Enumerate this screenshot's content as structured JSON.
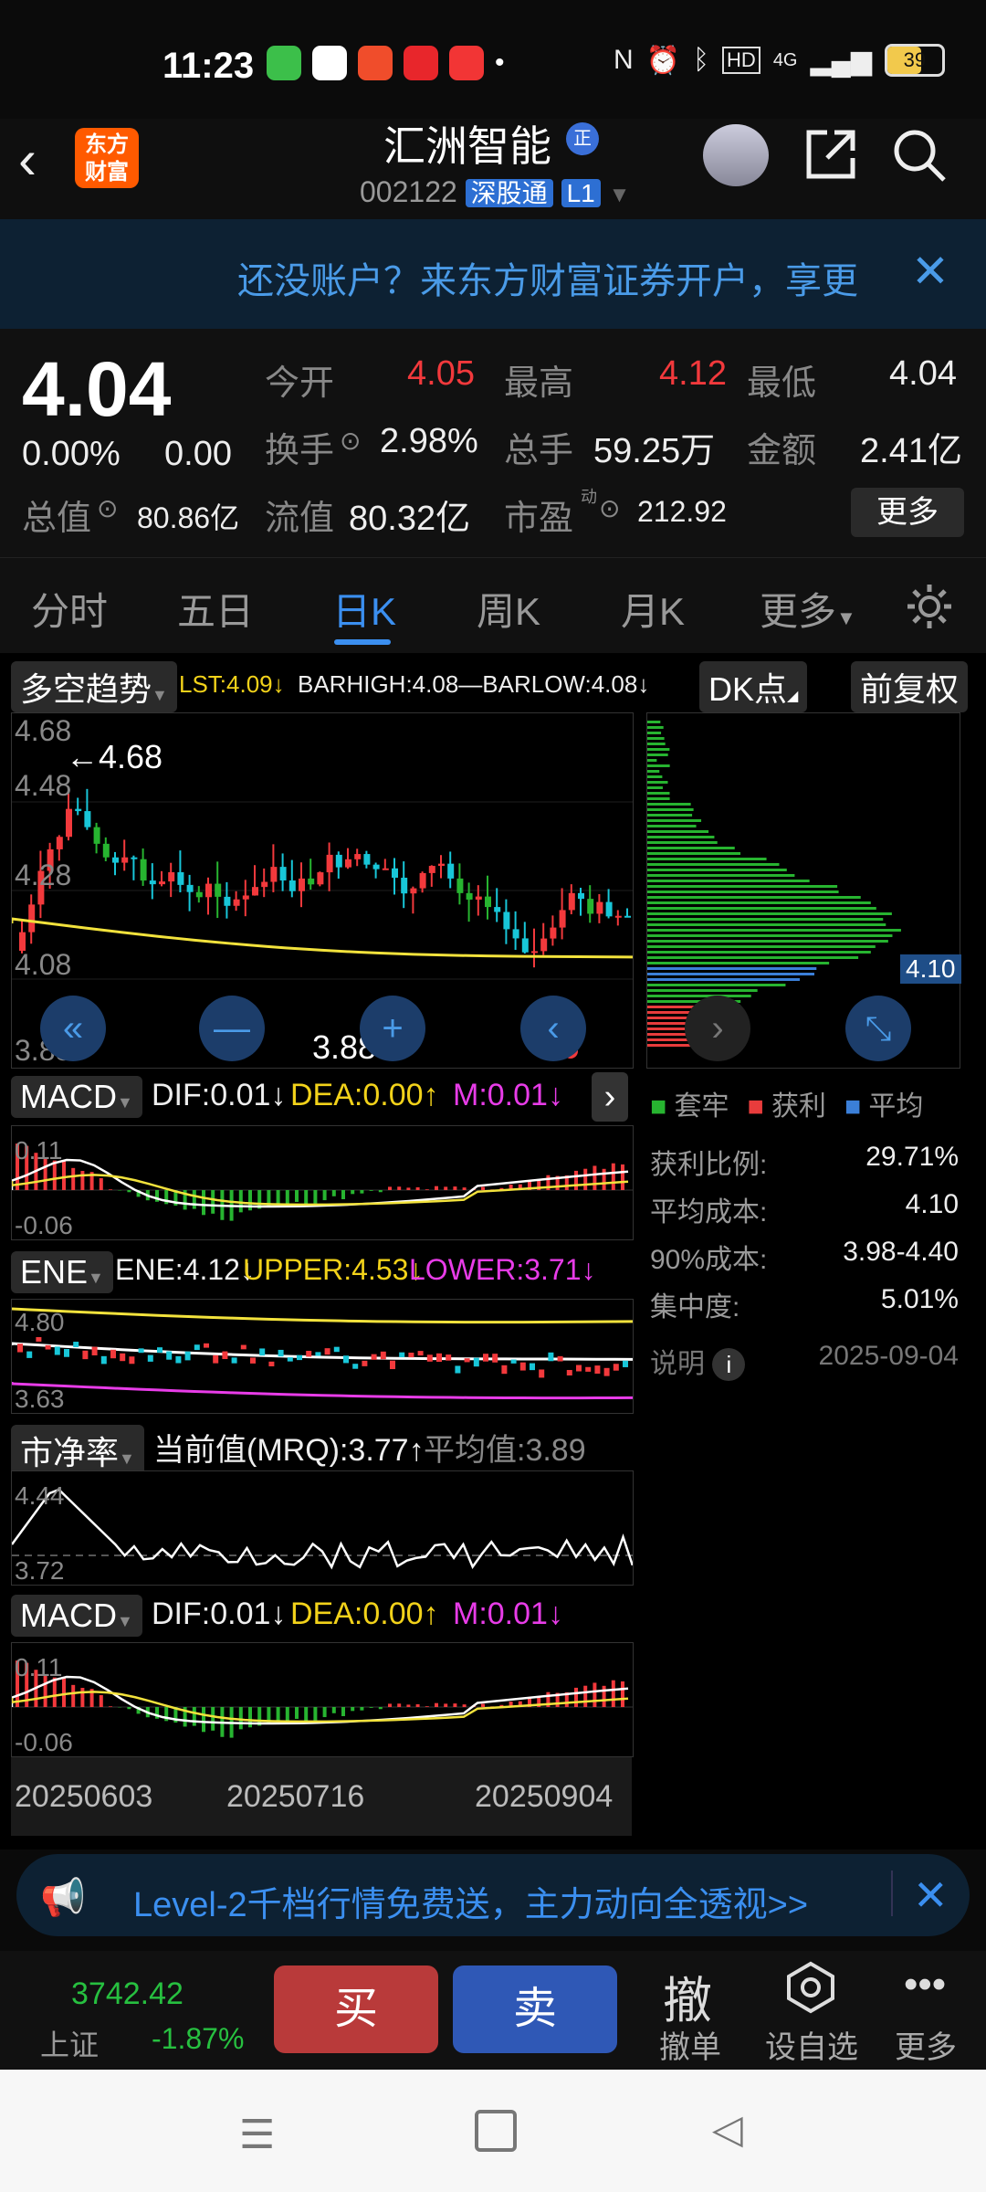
{
  "status": {
    "time": "11:23",
    "battery": "39",
    "network": "4G"
  },
  "header": {
    "logo_line1": "东方",
    "logo_line2": "财富",
    "name": "汇洲智能",
    "badge": "正",
    "code": "002122",
    "tag1": "深股通",
    "tag2": "L1"
  },
  "banner": {
    "text": "还没账户？来东方财富证券开户，享更"
  },
  "quote": {
    "price": "4.04",
    "change_pct": "0.00%",
    "change": "0.00",
    "open_label": "今开",
    "open": "4.05",
    "high_label": "最高",
    "high": "4.12",
    "low_label": "最低",
    "low": "4.04",
    "turnover_label": "换手",
    "turnover": "2.98%",
    "volume_label": "总手",
    "volume": "59.25万",
    "amount_label": "金额",
    "amount": "2.41亿",
    "mktcap_label": "总值",
    "mktcap": "80.86亿",
    "float_label": "流值",
    "float": "80.32亿",
    "pe_label": "市盈",
    "pe_sup": "动",
    "pe": "212.92",
    "more": "更多"
  },
  "tabs": [
    "分时",
    "五日",
    "日K",
    "周K",
    "月K",
    "更多"
  ],
  "kline": {
    "indicator": "多空趋势",
    "lst": "LST:4.09",
    "barhigh": "BARHIGH:4.08—BARLOW:4.08",
    "dk": "DK点",
    "adjust": "前复权",
    "y_top": "4.68",
    "y2": "4.48",
    "y3": "4.28",
    "y4": "4.08",
    "y_bot": "3.88",
    "max_label": "4.68",
    "min_label": "3.88",
    "chip_price": "4.10"
  },
  "macd1": {
    "name": "MACD",
    "dif": "DIF:0.01",
    "dea": "DEA:0.00",
    "m": "M:0.01",
    "top": "0.11",
    "bot": "-0.06"
  },
  "ene": {
    "name": "ENE",
    "ene": "ENE:4.12",
    "upper": "UPPER:4.53",
    "lower": "LOWER:3.71",
    "top": "4.80",
    "bot": "3.63"
  },
  "pb": {
    "name": "市净率",
    "current": "当前值(MRQ):3.77",
    "avg": "平均值:3.89",
    "top": "4.44",
    "bot": "3.72"
  },
  "macd2": {
    "name": "MACD",
    "dif": "DIF:0.01",
    "dea": "DEA:0.00",
    "m": "M:0.01",
    "top": "0.11",
    "bot": "-0.06"
  },
  "dates": [
    "20250603",
    "20250716",
    "20250904"
  ],
  "chips": {
    "legend1": "套牢",
    "legend2": "获利",
    "legend3": "平均",
    "profit_label": "获利比例:",
    "profit": "29.71%",
    "avg_label": "平均成本:",
    "avg": "4.10",
    "cost90_label": "90%成本:",
    "cost90": "3.98-4.40",
    "conc_label": "集中度:",
    "conc": "5.01%",
    "note_label": "说明",
    "date": "2025-09-04"
  },
  "bottom_banner": {
    "text": "Level-2千档行情免费送，主力动向全透视>>"
  },
  "bottombar": {
    "index_value": "3742.42",
    "index_name": "上证",
    "index_change": "-1.87%",
    "buy": "买",
    "sell": "卖",
    "cancel_icon_text": "撤",
    "cancel": "撤单",
    "watch": "设自选",
    "more": "更多"
  }
}
